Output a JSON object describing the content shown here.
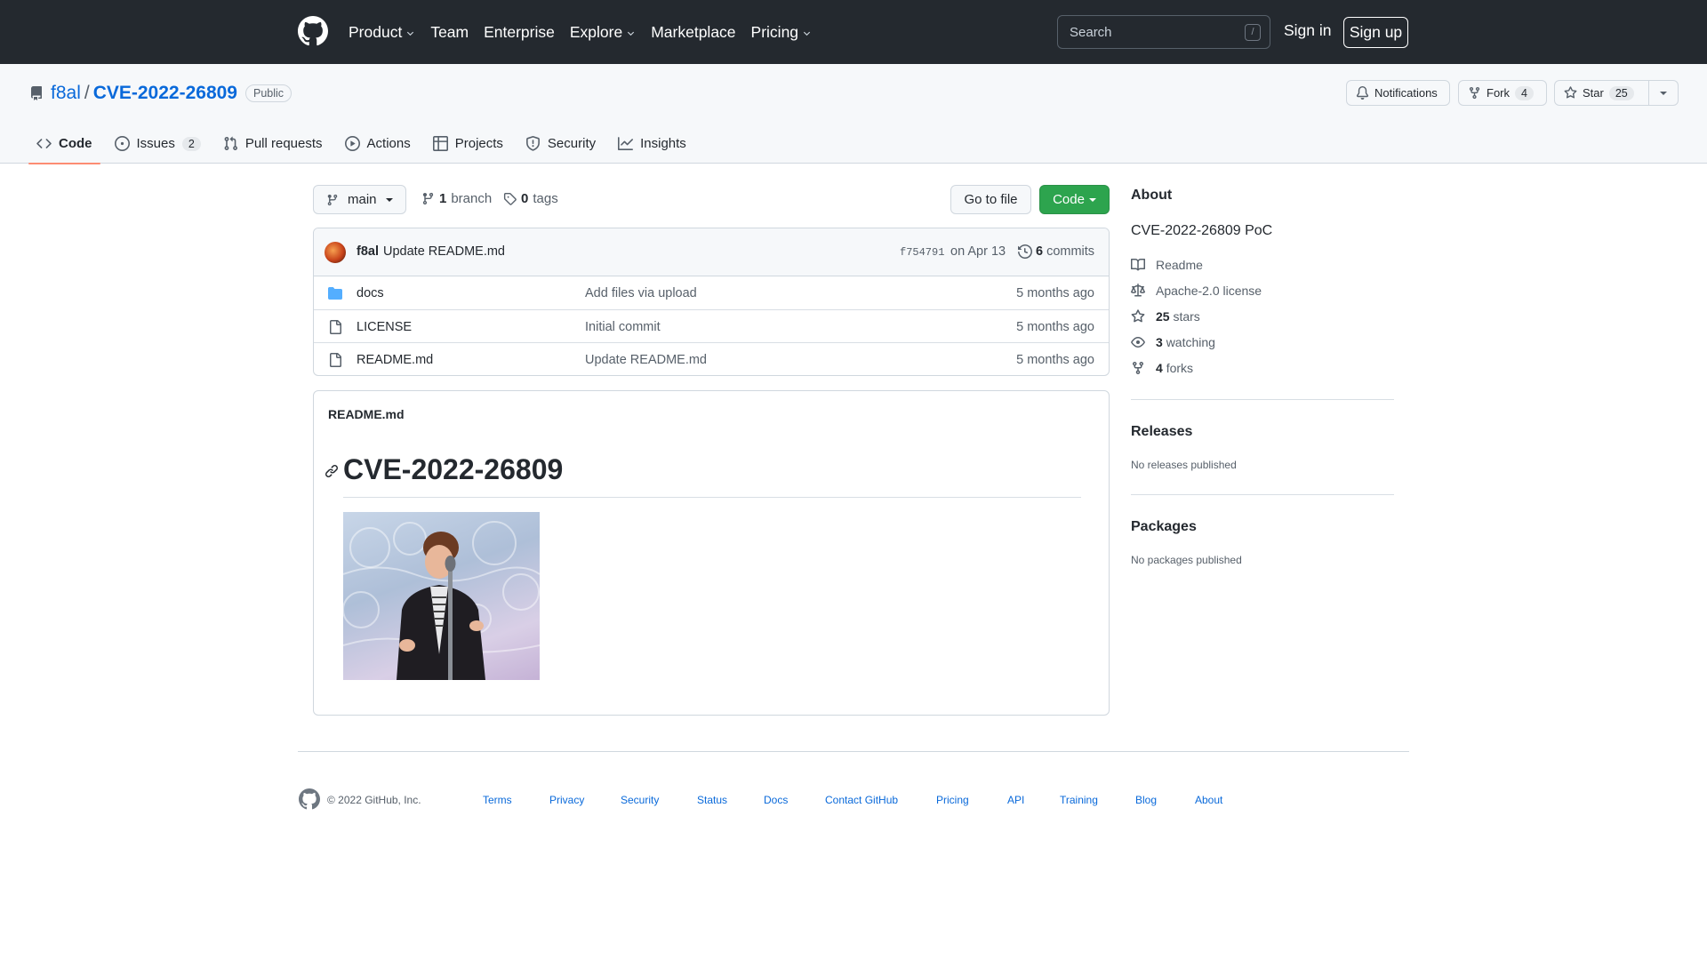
{
  "header": {
    "nav": [
      {
        "label": "Product",
        "dropdown": true
      },
      {
        "label": "Team",
        "dropdown": false
      },
      {
        "label": "Enterprise",
        "dropdown": false
      },
      {
        "label": "Explore",
        "dropdown": true
      },
      {
        "label": "Marketplace",
        "dropdown": false
      },
      {
        "label": "Pricing",
        "dropdown": true
      }
    ],
    "search_placeholder": "Search",
    "search_shortcut": "/",
    "sign_in": "Sign in",
    "sign_up": "Sign up"
  },
  "repo": {
    "owner": "f8al",
    "separator": "/",
    "name": "CVE-2022-26809",
    "visibility": "Public",
    "notifications_label": "Notifications",
    "fork_label": "Fork",
    "fork_count": "4",
    "star_label": "Star",
    "star_count": "25"
  },
  "tabs": [
    {
      "label": "Code",
      "active": true,
      "icon": "code-icon"
    },
    {
      "label": "Issues",
      "count": "2",
      "icon": "issue-opened-icon"
    },
    {
      "label": "Pull requests",
      "icon": "git-pull-request-icon"
    },
    {
      "label": "Actions",
      "icon": "play-icon"
    },
    {
      "label": "Projects",
      "icon": "table-icon"
    },
    {
      "label": "Security",
      "icon": "shield-icon"
    },
    {
      "label": "Insights",
      "icon": "graph-icon"
    }
  ],
  "toolbar": {
    "branch": "main",
    "branch_count": "1",
    "branch_word": "branch",
    "tag_count": "0",
    "tag_word": "tags",
    "go_to_file": "Go to file",
    "code": "Code"
  },
  "commit": {
    "author": "f8al",
    "message": "Update README.md",
    "sha": "f754791",
    "date": "on Apr 13",
    "count": "6",
    "count_word": "commits"
  },
  "files": [
    {
      "name": "docs",
      "type": "dir",
      "message": "Add files via upload",
      "age": "5 months ago"
    },
    {
      "name": "LICENSE",
      "type": "file",
      "message": "Initial commit",
      "age": "5 months ago"
    },
    {
      "name": "README.md",
      "type": "file",
      "message": "Update README.md",
      "age": "5 months ago"
    }
  ],
  "readme": {
    "label": "README.md",
    "heading": "CVE-2022-26809"
  },
  "sidebar": {
    "about_title": "About",
    "description": "CVE-2022-26809 PoC",
    "readme": "Readme",
    "license": "Apache-2.0 license",
    "stars_count": "25",
    "stars_word": "stars",
    "watching_count": "3",
    "watching_word": "watching",
    "forks_count": "4",
    "forks_word": "forks",
    "releases_title": "Releases",
    "releases_note": "No releases published",
    "packages_title": "Packages",
    "packages_note": "No packages published"
  },
  "footer": {
    "copyright": "© 2022 GitHub, Inc.",
    "links": [
      "Terms",
      "Privacy",
      "Security",
      "Status",
      "Docs",
      "Contact GitHub",
      "Pricing",
      "API",
      "Training",
      "Blog",
      "About"
    ]
  },
  "colors": {
    "header_bg": "#24292f",
    "link": "#0969da",
    "primary_button": "#2da44e",
    "active_tab_underline": "#fd8c73",
    "folder": "#54aeff"
  }
}
